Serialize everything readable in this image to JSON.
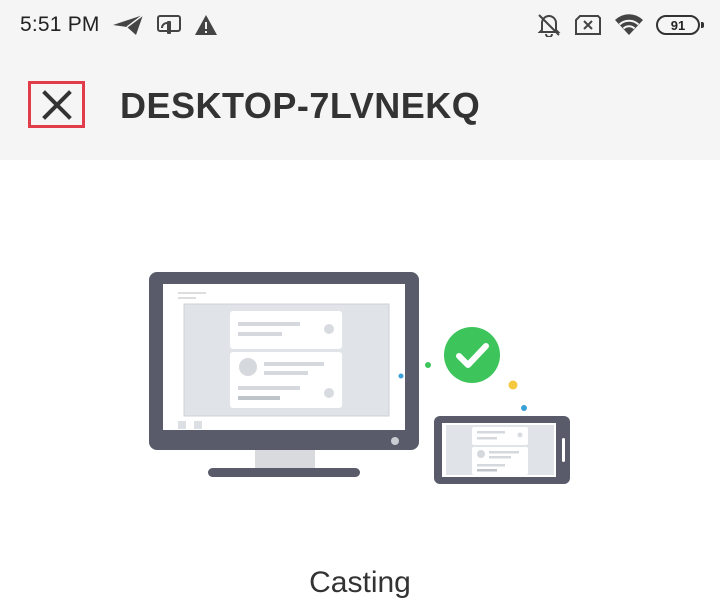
{
  "status_bar": {
    "time": "5:51 PM",
    "left_icons": [
      "send-icon",
      "cast-icon",
      "warning-icon"
    ],
    "right_icons": [
      "alarm-off-icon",
      "no-sim-icon",
      "wifi-icon",
      "battery-icon"
    ],
    "battery": "91"
  },
  "header": {
    "close_icon": "close-icon",
    "title": "DESKTOP-7LVNEKQ",
    "highlight_color": "#e03c4a"
  },
  "illustration": {
    "icons": [
      "monitor-icon",
      "phone-icon",
      "checkmark-icon"
    ],
    "accent": "#3dc55c"
  },
  "status": {
    "label": "Casting"
  }
}
